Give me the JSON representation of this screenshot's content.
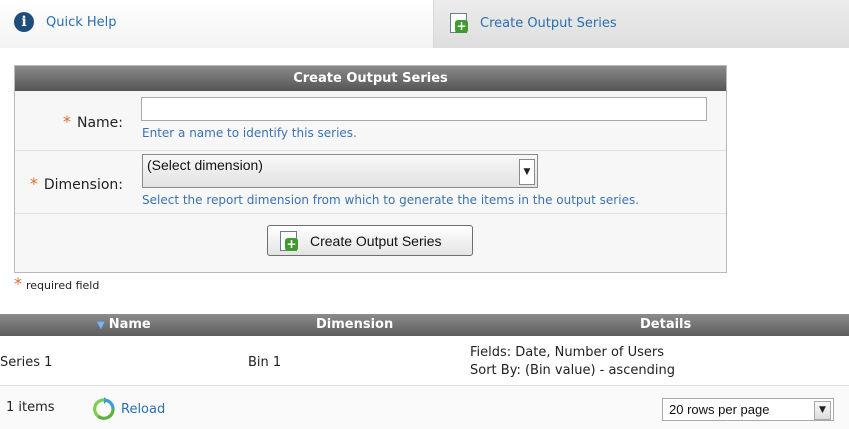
{
  "toolbar": {
    "quick_help": "Quick Help",
    "create_output_series": "Create Output Series"
  },
  "form": {
    "title": "Create Output Series",
    "name_label": "Name:",
    "name_value": "",
    "name_hint": "Enter a name to identify this series.",
    "dimension_label": "Dimension:",
    "dimension_selected": "(Select dimension)",
    "dimension_hint": "Select the report dimension from which to generate the items in the output series.",
    "submit_label": "Create Output Series",
    "required_marker": "*",
    "required_note": "required field"
  },
  "grid": {
    "columns": [
      "Name",
      "Dimension",
      "Details"
    ],
    "sorted_column": "Name",
    "rows": [
      {
        "name": "Series 1",
        "dimension": "Bin 1",
        "details": [
          "Fields: Date, Number of Users",
          "Sort By: (Bin value) - ascending"
        ]
      }
    ],
    "items_count": "1 items",
    "reload_label": "Reload",
    "rows_per_page": "20 rows per page"
  },
  "colors": {
    "link": "#2a6fb0",
    "required": "#e06a2c",
    "header_dark": "#5c5c5c",
    "add_green": "#3f9b30"
  },
  "icons": {
    "help": "info-icon",
    "create": "add-page-icon",
    "reload": "reload-icon",
    "dropdown": "chevron-down-icon"
  }
}
